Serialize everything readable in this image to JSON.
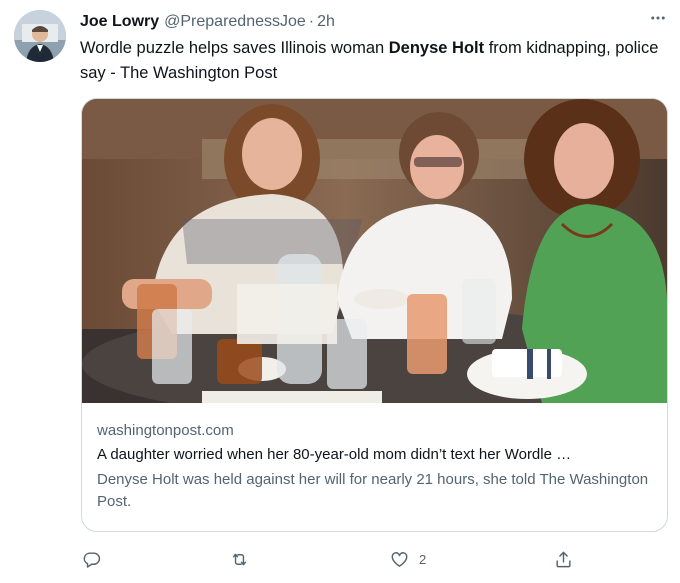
{
  "author": {
    "name": "Joe Lowry",
    "handle": "@PreparednessJoe",
    "separator": "·",
    "time": "2h"
  },
  "tweet": {
    "text_before": "Wordle puzzle helps saves Illinois woman ",
    "text_bold": "Denyse Holt",
    "text_after": " from kidnapping, police say - The Washington Post"
  },
  "card": {
    "domain": "washingtonpost.com",
    "title": "A daughter worried when her 80-year-old mom didn’t text her Wordle …",
    "description": "Denyse Holt was held against her will for nearly 21 hours, she told The Washington Post."
  },
  "actions": {
    "reply_count": "",
    "retweet_count": "",
    "like_count": "2"
  },
  "icons": {
    "more": "more-horizontal-icon",
    "reply": "reply-icon",
    "retweet": "retweet-icon",
    "like": "heart-icon",
    "share": "share-icon"
  },
  "colors": {
    "primary_text": "#0f1419",
    "secondary_text": "#536471",
    "border": "#cfd9de"
  }
}
